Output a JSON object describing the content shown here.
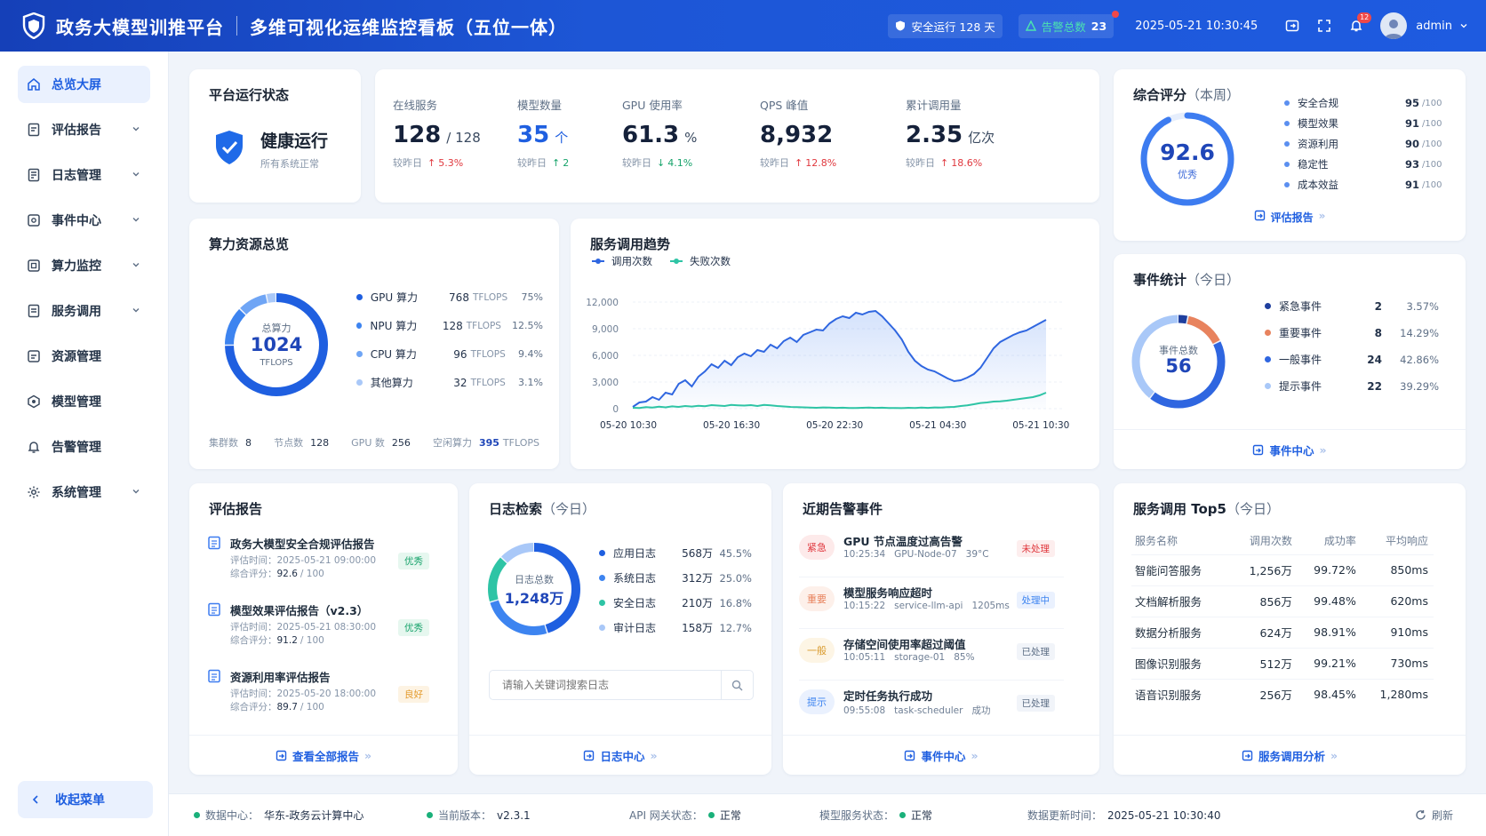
{
  "header": {
    "title": "政务大模型训推平台",
    "subtitle": "多维可视化运维监控看板（五位一体）",
    "safe_label": "安全运行 128 天",
    "alert_label": "告警总数",
    "alert_count": "23",
    "datetime": "2025-05-21 10:30:45",
    "notif_badge": "12",
    "user": "admin"
  },
  "sidebar": {
    "items": [
      {
        "label": "总览大屏",
        "icon": "home-icon",
        "active": true,
        "has_children": false
      },
      {
        "label": "评估报告",
        "icon": "report-icon",
        "has_children": true
      },
      {
        "label": "日志管理",
        "icon": "log-icon",
        "has_children": true
      },
      {
        "label": "事件中心",
        "icon": "event-icon",
        "has_children": true
      },
      {
        "label": "算力监控",
        "icon": "compute-icon",
        "has_children": true
      },
      {
        "label": "服务调用",
        "icon": "service-icon",
        "has_children": true
      },
      {
        "label": "资源管理",
        "icon": "resource-icon",
        "has_children": false
      },
      {
        "label": "模型管理",
        "icon": "model-icon",
        "has_children": false
      },
      {
        "label": "告警管理",
        "icon": "bell-icon",
        "has_children": false
      },
      {
        "label": "系统管理",
        "icon": "gear-icon",
        "has_children": true
      }
    ],
    "collapse_label": "收起菜单"
  },
  "status_card": {
    "title": "平台运行状态",
    "state": "健康运行",
    "desc": "所有系统正常"
  },
  "kpis": [
    {
      "label": "在线服务",
      "value": "128",
      "unit": "/ 128",
      "cmp": "较昨日",
      "delta": "5.3%",
      "dir": "up",
      "color": "red",
      "value_color": "#15213a"
    },
    {
      "label": "模型数量",
      "value": "35",
      "unit": "个",
      "cmp": "较昨日",
      "delta": "2",
      "dir": "up",
      "color": "green",
      "value_color": "#1f5fe0"
    },
    {
      "label": "GPU 使用率",
      "value": "61.3",
      "unit": "%",
      "cmp": "较昨日",
      "delta": "4.1%",
      "dir": "down",
      "color": "green",
      "value_color": "#15213a"
    },
    {
      "label": "QPS 峰值",
      "value": "8,932",
      "unit": "",
      "cmp": "较昨日",
      "delta": "12.8%",
      "dir": "up",
      "color": "red",
      "value_color": "#15213a"
    },
    {
      "label": "累计调用量",
      "value": "2.35",
      "unit": "亿次",
      "cmp": "较昨日",
      "delta": "18.6%",
      "dir": "up",
      "color": "red",
      "value_color": "#15213a"
    }
  ],
  "score": {
    "title": "综合评分",
    "title_sub": "（本周）",
    "value": "92.6",
    "value_fraction": 0.926,
    "grade": "优秀",
    "items": [
      {
        "label": "安全合规",
        "score": "95",
        "max": "/100"
      },
      {
        "label": "模型效果",
        "score": "91",
        "max": "/100"
      },
      {
        "label": "资源利用",
        "score": "90",
        "max": "/100"
      },
      {
        "label": "稳定性",
        "score": "93",
        "max": "/100"
      },
      {
        "label": "成本效益",
        "score": "91",
        "max": "/100"
      }
    ],
    "link": "评估报告"
  },
  "compute": {
    "title": "算力资源总览",
    "center_label": "总算力",
    "center_value": "1024",
    "center_unit": "TFLOPS",
    "items": [
      {
        "label": "GPU 算力",
        "value": "768",
        "unit": "TFLOPS",
        "pct": "75%",
        "frac": 0.75,
        "color": "#1f5fe0"
      },
      {
        "label": "NPU 算力",
        "value": "128",
        "unit": "TFLOPS",
        "pct": "12.5%",
        "frac": 0.125,
        "color": "#3d84f0"
      },
      {
        "label": "CPU 算力",
        "value": "96",
        "unit": "TFLOPS",
        "pct": "9.4%",
        "frac": 0.094,
        "color": "#6fa5f5"
      },
      {
        "label": "其他算力",
        "value": "32",
        "unit": "TFLOPS",
        "pct": "3.1%",
        "frac": 0.031,
        "color": "#a9c8f8"
      }
    ],
    "footer": [
      {
        "label": "集群数",
        "value": "8",
        "unit": ""
      },
      {
        "label": "节点数",
        "value": "128",
        "unit": ""
      },
      {
        "label": "GPU 数",
        "value": "256",
        "unit": ""
      },
      {
        "label": "空闲算力",
        "value": "395",
        "unit": "TFLOPS"
      }
    ]
  },
  "chart_data": {
    "type": "line",
    "title": "服务调用趋势",
    "x": [
      "05-20 10:30",
      "05-20 16:30",
      "05-20 22:30",
      "05-21 04:30",
      "05-21 10:30"
    ],
    "ylim": [
      0,
      12000
    ],
    "yticks": [
      "12,000",
      "9,000",
      "6,000",
      "3,000",
      "0"
    ],
    "series": [
      {
        "name": "调用次数",
        "color": "#2f66e0",
        "values": [
          200,
          700,
          800,
          1300,
          1000,
          1800,
          1600,
          2800,
          3200,
          2500,
          3600,
          4200,
          5000,
          4600,
          5400,
          4900,
          5800,
          6200,
          5900,
          6600,
          6400,
          7200,
          6800,
          7600,
          8000,
          7500,
          8300,
          8600,
          8900,
          8800,
          9600,
          10100,
          10400,
          10200,
          10800,
          10600,
          10900,
          11000,
          10400,
          9600,
          8800,
          7800,
          6400,
          5400,
          4800,
          4400,
          4200,
          3800,
          3400,
          3100,
          3200,
          3500,
          3900,
          4600,
          5700,
          6800,
          7500,
          7900,
          8300,
          8600,
          8800,
          9200,
          9600,
          10000
        ]
      },
      {
        "name": "失败次数",
        "color": "#2ec4a5",
        "values": [
          100,
          80,
          180,
          120,
          220,
          150,
          260,
          200,
          300,
          240,
          320,
          280,
          400,
          350,
          300,
          420,
          380,
          350,
          400,
          300,
          420,
          380,
          300,
          250,
          200,
          180,
          150,
          120,
          100,
          140,
          120,
          90,
          110,
          80,
          70,
          100,
          120,
          90,
          110,
          80,
          70,
          60,
          100,
          80,
          120,
          90,
          140,
          130,
          180,
          200,
          300,
          380,
          500,
          640,
          700,
          800,
          820,
          900,
          1000,
          1100,
          1200,
          1300,
          1500,
          1800
        ]
      }
    ]
  },
  "score_link": "评估报告",
  "events": {
    "title": "事件统计",
    "title_sub": "（今日）",
    "center_label": "事件总数",
    "center_value": "56",
    "items": [
      {
        "label": "紧急事件",
        "count": "2",
        "pct": "3.57%",
        "frac": 0.0357,
        "color": "#1f3f9e"
      },
      {
        "label": "重要事件",
        "count": "8",
        "pct": "14.29%",
        "frac": 0.1429,
        "color": "#e8835e"
      },
      {
        "label": "一般事件",
        "count": "24",
        "pct": "42.86%",
        "frac": 0.4286,
        "color": "#2f66e0"
      },
      {
        "label": "提示事件",
        "count": "22",
        "pct": "39.29%",
        "frac": 0.3929,
        "color": "#a9c8f8"
      }
    ],
    "link": "事件中心"
  },
  "reports": {
    "title": "评估报告",
    "items": [
      {
        "title": "政务大模型安全合规评估报告",
        "time_label": "评估时间：",
        "time": "2025-05-21 09:00:00",
        "score_label": "综合评分：",
        "score": "92.6",
        "max": "/ 100",
        "tag": "优秀",
        "tag_color": "#17a36b",
        "tag_bg": "#e6f7ef"
      },
      {
        "title": "模型效果评估报告（v2.3）",
        "time_label": "评估时间：",
        "time": "2025-05-21 08:30:00",
        "score_label": "综合评分：",
        "score": "91.2",
        "max": "/ 100",
        "tag": "优秀",
        "tag_color": "#17a36b",
        "tag_bg": "#e6f7ef"
      },
      {
        "title": "资源利用率评估报告",
        "time_label": "评估时间：",
        "time": "2025-05-20 18:00:00",
        "score_label": "综合评分：",
        "score": "89.7",
        "max": "/ 100",
        "tag": "良好",
        "tag_color": "#e39a2c",
        "tag_bg": "#fdf3e3"
      }
    ],
    "link": "查看全部报告"
  },
  "logs": {
    "title": "日志检索",
    "title_sub": "（今日）",
    "center_label": "日志总数",
    "center_value": "1,248万",
    "items": [
      {
        "label": "应用日志",
        "value": "568万",
        "pct": "45.5%",
        "frac": 0.455,
        "color": "#1f5fe0"
      },
      {
        "label": "系统日志",
        "value": "312万",
        "pct": "25.0%",
        "frac": 0.25,
        "color": "#3d84f0"
      },
      {
        "label": "安全日志",
        "value": "210万",
        "pct": "16.8%",
        "frac": 0.168,
        "color": "#2ec4a5"
      },
      {
        "label": "审计日志",
        "value": "158万",
        "pct": "12.7%",
        "frac": 0.127,
        "color": "#a9c8f8"
      }
    ],
    "search_placeholder": "请输入关键词搜索日志",
    "link": "日志中心"
  },
  "alerts": {
    "title": "近期告警事件",
    "items": [
      {
        "level": "紧急",
        "lvl_color": "#e0383e",
        "lvl_bg": "#fdeaea",
        "title": "GPU 节点温度过高告警",
        "meta": "10:25:34   GPU-Node-07   39°C",
        "status": "未处理",
        "st_color": "#e0383e",
        "st_bg": "#fdeeee"
      },
      {
        "level": "重要",
        "lvl_color": "#e8835e",
        "lvl_bg": "#fdf0ea",
        "title": "模型服务响应超时",
        "meta": "10:15:22   service-llm-api   1205ms",
        "status": "处理中",
        "st_color": "#3d84f0",
        "st_bg": "#eaf1fe"
      },
      {
        "level": "一般",
        "lvl_color": "#d99a2c",
        "lvl_bg": "#fdf5e5",
        "title": "存储空间使用率超过阈值",
        "meta": "10:05:11   storage-01   85%",
        "status": "已处理",
        "st_color": "#5e6f86",
        "st_bg": "#f1f4f9"
      },
      {
        "level": "提示",
        "lvl_color": "#3d84f0",
        "lvl_bg": "#eaf1fe",
        "title": "定时任务执行成功",
        "meta": "09:55:08   task-scheduler   成功",
        "status": "已处理",
        "st_color": "#5e6f86",
        "st_bg": "#f1f4f9"
      }
    ],
    "link": "事件中心"
  },
  "services": {
    "title": "服务调用 Top5",
    "title_sub": "（今日）",
    "headers": [
      "服务名称",
      "调用次数",
      "成功率",
      "平均响应"
    ],
    "rows": [
      [
        "智能问答服务",
        "1,256万",
        "99.72%",
        "850ms"
      ],
      [
        "文档解析服务",
        "856万",
        "99.48%",
        "620ms"
      ],
      [
        "数据分析服务",
        "624万",
        "98.91%",
        "910ms"
      ],
      [
        "图像识别服务",
        "512万",
        "99.21%",
        "730ms"
      ],
      [
        "语音识别服务",
        "256万",
        "98.45%",
        "1,280ms"
      ]
    ],
    "link": "服务调用分析"
  },
  "statusbar": {
    "dc_label": "数据中心：",
    "dc_value": "华东-政务云计算中心",
    "ver_label": "当前版本：",
    "ver_value": "v2.3.1",
    "api_label": "API 网关状态：",
    "api_value": "正常",
    "model_label": "模型服务状态：",
    "model_value": "正常",
    "upd_label": "数据更新时间：",
    "upd_value": "2025-05-21 10:30:40",
    "refresh": "刷新"
  }
}
